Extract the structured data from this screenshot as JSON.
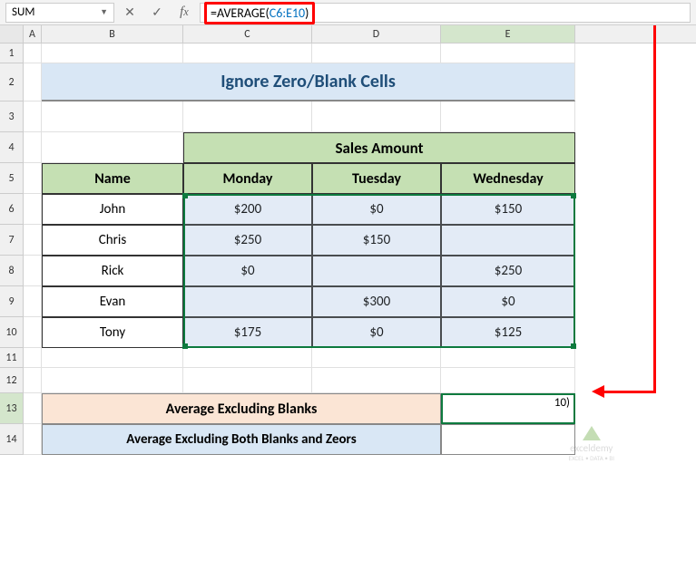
{
  "name_box": "SUM",
  "formula": {
    "prefix": "=AVERAGE(",
    "ref": "C6:E10",
    "suffix": ")"
  },
  "columns": [
    "A",
    "B",
    "C",
    "D",
    "E"
  ],
  "rows": [
    "1",
    "2",
    "3",
    "4",
    "5",
    "6",
    "7",
    "8",
    "9",
    "10",
    "11",
    "12",
    "13",
    "14"
  ],
  "title": "Ignore Zero/Blank Cells",
  "headers": {
    "merged": "Sales Amount",
    "name": "Name",
    "days": [
      "Monday",
      "Tuesday",
      "Wednesday"
    ]
  },
  "people": [
    {
      "name": "John",
      "vals": [
        "$200",
        "$0",
        "$150"
      ]
    },
    {
      "name": "Chris",
      "vals": [
        "$250",
        "$150",
        ""
      ]
    },
    {
      "name": "Rick",
      "vals": [
        "$0",
        "",
        "$250"
      ]
    },
    {
      "name": "Evan",
      "vals": [
        "",
        "$300",
        "$0"
      ]
    },
    {
      "name": "Tony",
      "vals": [
        "$175",
        "$0",
        "$125"
      ]
    }
  ],
  "avg_rows": {
    "blanks": "Average Excluding Blanks",
    "both": "Average Excluding Both Blanks and Zeors",
    "e13_display": "10)"
  },
  "watermark": {
    "brand": "exceldemy",
    "tag": "EXCEL • DATA • BI"
  },
  "chart_data": {
    "type": "table",
    "title": "Ignore Zero/Blank Cells",
    "columns": [
      "Name",
      "Monday",
      "Tuesday",
      "Wednesday"
    ],
    "rows": [
      [
        "John",
        200,
        0,
        150
      ],
      [
        "Chris",
        250,
        150,
        null
      ],
      [
        "Rick",
        0,
        null,
        250
      ],
      [
        "Evan",
        null,
        300,
        0
      ],
      [
        "Tony",
        175,
        0,
        125
      ]
    ],
    "formula_shown": "=AVERAGE(C6:E10)",
    "result_labels": [
      "Average Excluding Blanks",
      "Average Excluding Both Blanks and Zeors"
    ]
  }
}
